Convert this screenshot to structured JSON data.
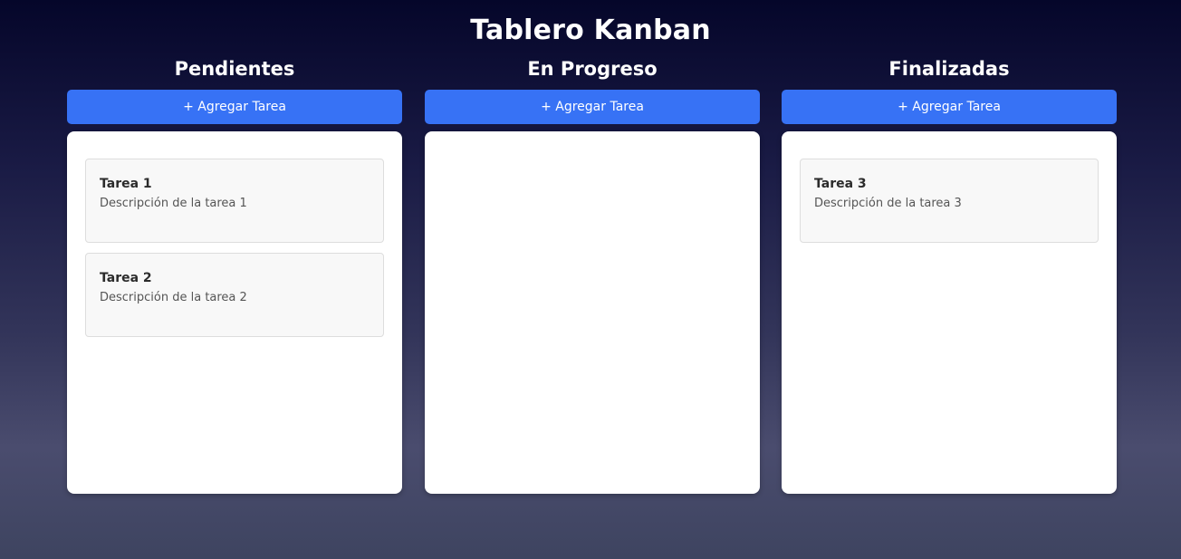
{
  "board": {
    "title": "Tablero Kanban"
  },
  "columns": [
    {
      "title": "Pendientes",
      "add_label": "+ Agregar Tarea",
      "tasks": [
        {
          "title": "Tarea 1",
          "description": "Descripción de la tarea 1"
        },
        {
          "title": "Tarea 2",
          "description": "Descripción de la tarea 2"
        }
      ]
    },
    {
      "title": "En Progreso",
      "add_label": "+ Agregar Tarea",
      "tasks": []
    },
    {
      "title": "Finalizadas",
      "add_label": "+ Agregar Tarea",
      "tasks": [
        {
          "title": "Tarea 3",
          "description": "Descripción de la tarea 3"
        }
      ]
    }
  ],
  "colors": {
    "accent": "#3772f5",
    "card_background": "#f8f8f8",
    "column_background": "#ffffff"
  }
}
